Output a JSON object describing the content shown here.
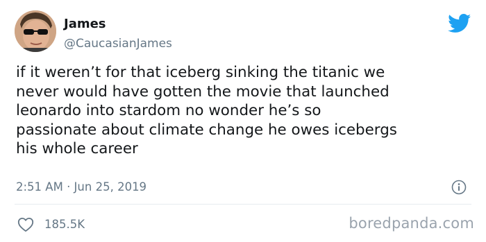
{
  "user": {
    "name": "James",
    "handle": "@CaucasianJames"
  },
  "tweet": {
    "lines": [
      "if it weren’t for that iceberg sinking the titanic we",
      "never would have gotten the movie that launched",
      "leonardo into stardom no wonder he’s so",
      "passionate about climate change he owes icebergs",
      "his whole career"
    ],
    "timestamp": "2:51 AM · Jun 25, 2019",
    "likes": "185.5K"
  },
  "icons": {
    "brand": "twitter-bird-icon",
    "info": "info-icon",
    "like": "heart-icon"
  },
  "watermark": "boredpanda.com",
  "colors": {
    "twitter_blue": "#1da1f2",
    "secondary_text": "#657786",
    "primary_text": "#14171a"
  }
}
